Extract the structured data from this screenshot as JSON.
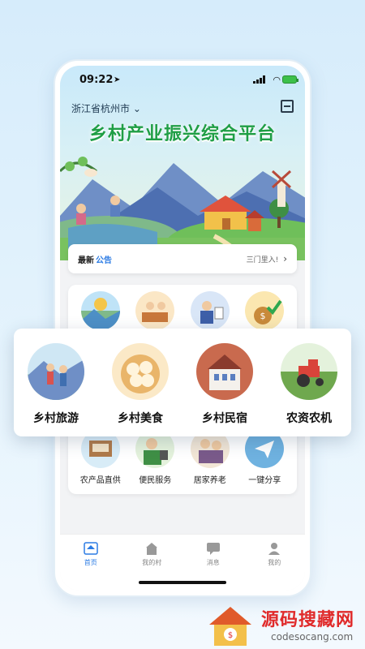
{
  "status": {
    "time": "09:22"
  },
  "header": {
    "city": "浙江省杭州市",
    "title": "乡村产业振兴综合平台"
  },
  "notice": {
    "label1": "最新",
    "label2": "公告",
    "text": "三门里入!"
  },
  "services_top": [
    {
      "icon": "scenery-icon"
    },
    {
      "icon": "market-stall-icon"
    },
    {
      "icon": "official-icon"
    },
    {
      "icon": "money-bag-icon"
    }
  ],
  "services_bottom": [
    {
      "label": "农产品直供",
      "icon": "produce-stall-icon"
    },
    {
      "label": "便民服务",
      "icon": "service-worker-icon"
    },
    {
      "label": "居家养老",
      "icon": "elderly-care-icon"
    },
    {
      "label": "一键分享",
      "icon": "share-icon"
    }
  ],
  "featured": [
    {
      "label": "乡村旅游",
      "icon": "hikers-icon"
    },
    {
      "label": "乡村美食",
      "icon": "dumplings-icon"
    },
    {
      "label": "乡村民宿",
      "icon": "guesthouse-icon"
    },
    {
      "label": "农资农机",
      "icon": "tractor-icon"
    }
  ],
  "tabs": [
    {
      "label": "首页",
      "icon": "home-icon",
      "active": true
    },
    {
      "label": "我的村",
      "icon": "village-icon",
      "active": false
    },
    {
      "label": "消息",
      "icon": "message-icon",
      "active": false
    },
    {
      "label": "我的",
      "icon": "user-icon",
      "active": false
    }
  ],
  "watermark": {
    "title": "源码搜藏网",
    "url": "codesocang.com"
  },
  "colors": {
    "title_green": "#1f9e45",
    "accent_blue": "#2b7be4",
    "watermark_red": "#e02a2a"
  }
}
